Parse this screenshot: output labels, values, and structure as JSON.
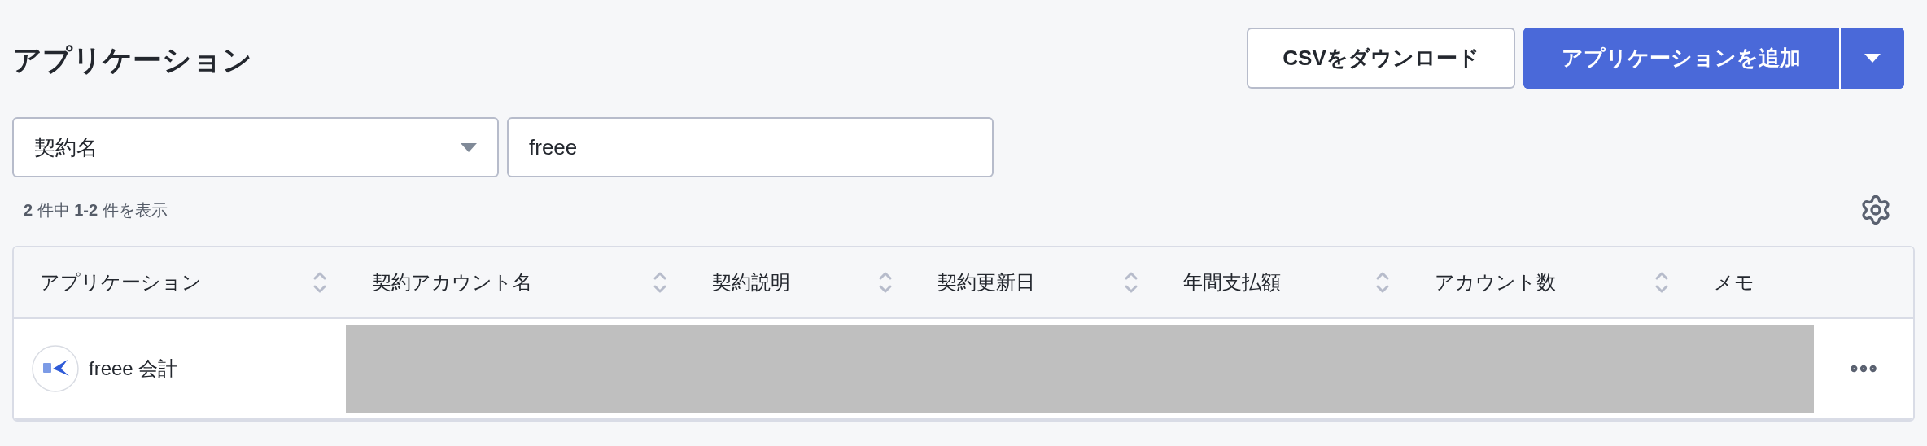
{
  "page": {
    "title": "アプリケーション"
  },
  "actions": {
    "download_button": "CSVをダウンロード",
    "add_button": "アプリケーションを追加"
  },
  "filter": {
    "field_select": "契約名",
    "search_value": "freee"
  },
  "result_count": "**2** 件中 **1-2** 件を表示",
  "table": {
    "columns": [
      {
        "label": "アプリケーション",
        "sortable": true
      },
      {
        "label": "契約アカウント名",
        "sortable": true
      },
      {
        "label": "契約説明",
        "sortable": true
      },
      {
        "label": "契約更新日",
        "sortable": true
      },
      {
        "label": "年間支払額",
        "sortable": true
      },
      {
        "label": "アカウント数",
        "sortable": true
      },
      {
        "label": "メモ",
        "sortable": false
      }
    ],
    "rows": [
      {
        "application": "freee 会計",
        "redacted": true
      }
    ]
  }
}
